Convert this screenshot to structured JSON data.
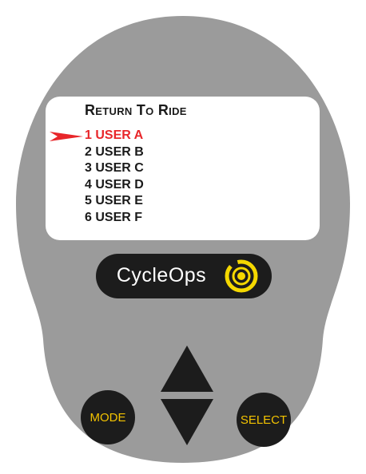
{
  "screen": {
    "title": "Return To Ride",
    "items": [
      {
        "label": "1 USER A",
        "selected": true
      },
      {
        "label": "2 USER B",
        "selected": false
      },
      {
        "label": "3 USER C",
        "selected": false
      },
      {
        "label": "4 USER D",
        "selected": false
      },
      {
        "label": "5 USER E",
        "selected": false
      },
      {
        "label": "6 USER F",
        "selected": false
      }
    ]
  },
  "logo": {
    "text": "CycleOps"
  },
  "buttons": {
    "mode": "MODE",
    "select": "SELECT",
    "up_icon": "triangle-up-icon",
    "down_icon": "triangle-down-icon"
  },
  "colors": {
    "body": "#9b9b9b",
    "screen": "#ffffff",
    "text": "#1a1a1a",
    "selected": "#e8262a",
    "button": "#1c1c1c",
    "button_label": "#f2c200",
    "logo_accent": "#f5d800"
  }
}
